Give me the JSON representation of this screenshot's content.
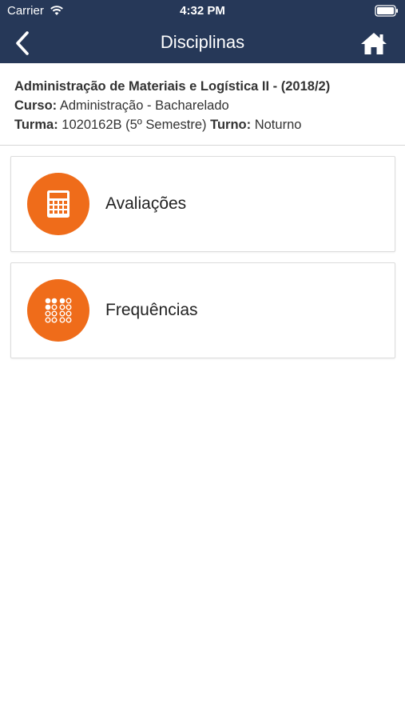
{
  "status_bar": {
    "carrier": "Carrier",
    "time": "4:32 PM"
  },
  "nav": {
    "title": "Disciplinas",
    "back_icon": "chevron-left-icon",
    "home_icon": "home-icon"
  },
  "course": {
    "title": "Administração de Materiais e Logística II - (2018/2)",
    "curso_label": "Curso:",
    "curso_value": "Administração - Bacharelado",
    "turma_label": "Turma:",
    "turma_value": "1020162B (5º Semestre)",
    "turno_label": "Turno:",
    "turno_value": "Noturno"
  },
  "menu": [
    {
      "label": "Avaliações",
      "icon": "calculator-icon"
    },
    {
      "label": "Frequências",
      "icon": "attendance-dots-icon"
    }
  ],
  "colors": {
    "header": "#263858",
    "accent": "#ef6c1a"
  }
}
